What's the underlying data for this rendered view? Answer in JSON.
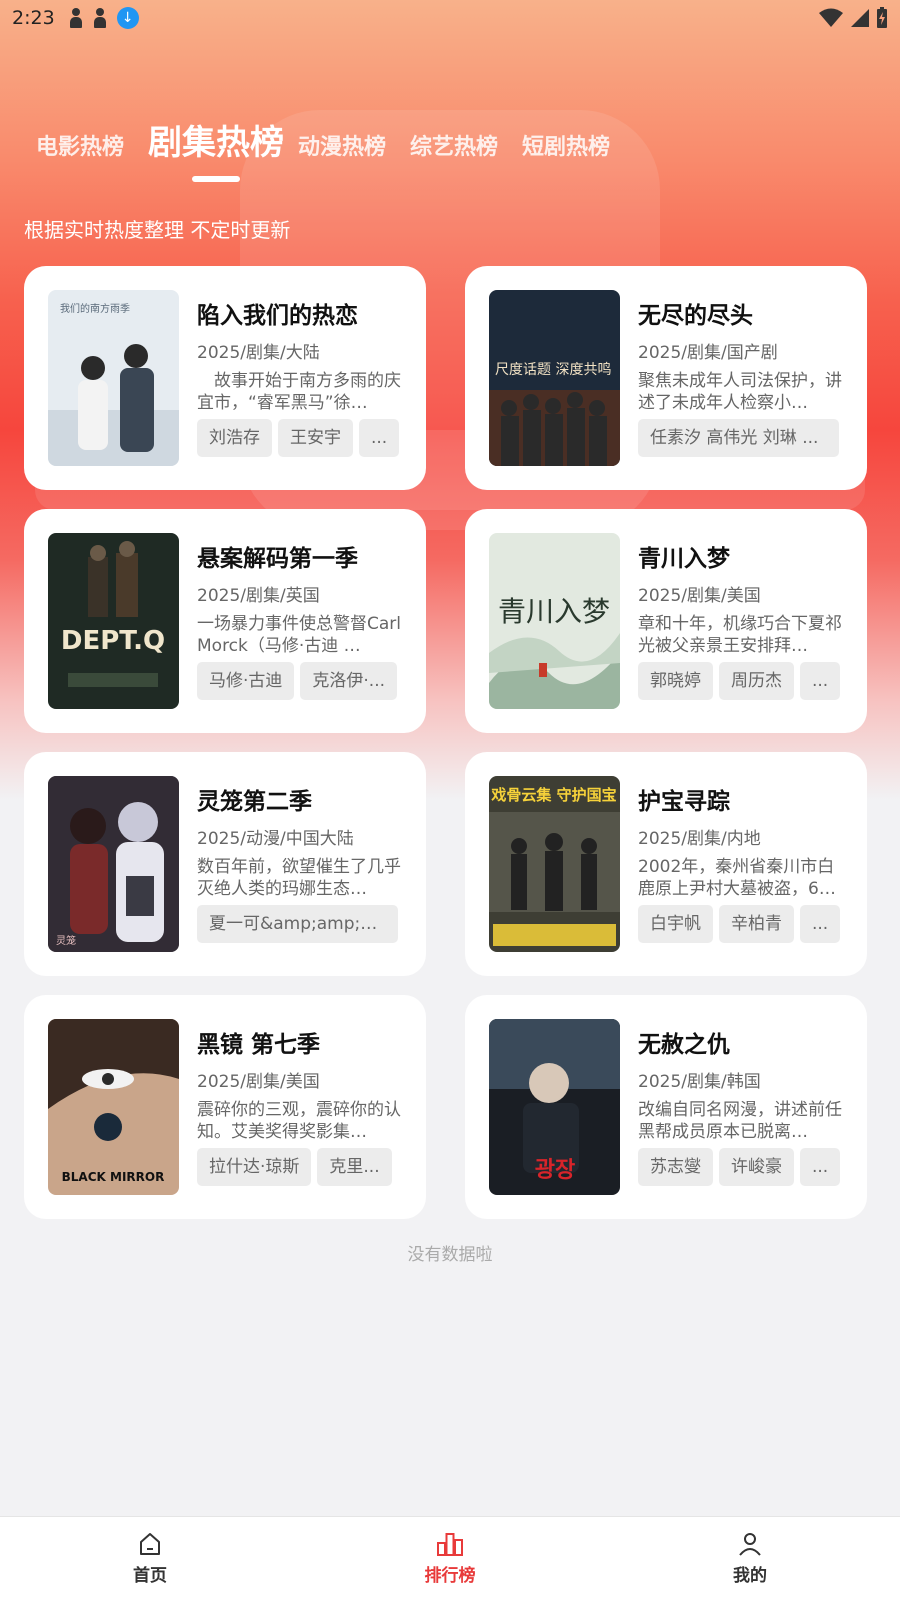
{
  "status_bar": {
    "time": "2:23"
  },
  "tabs": [
    {
      "label": "电影热榜",
      "active": false
    },
    {
      "label": "剧集热榜",
      "active": true
    },
    {
      "label": "动漫热榜",
      "active": false
    },
    {
      "label": "综艺热榜",
      "active": false
    },
    {
      "label": "短剧热榜",
      "active": false
    }
  ],
  "subtitle": "根据实时热度整理 不定时更新",
  "cards": [
    {
      "title": "陷入我们的热恋",
      "meta": "2025/剧集/大陆",
      "desc": "　故事开始于南方多雨的庆宜市，“睿军黑马”徐…",
      "tags": [
        "刘浩存",
        "王安宇",
        "..."
      ]
    },
    {
      "title": "无尽的尽头",
      "meta": "2025/剧集/国产剧",
      "desc": "聚焦未成年人司法保护，讲述了未成年人检察小…",
      "tags": [
        "任素汐 高伟光 刘琳 ..."
      ]
    },
    {
      "title": "悬案解码第一季",
      "meta": "2025/剧集/英国",
      "desc": "一场暴力事件使总警督Carl Morck（马修·古迪 …",
      "tags": [
        "马修·古迪",
        "克洛伊·..."
      ]
    },
    {
      "title": "青川入梦",
      "meta": "2025/剧集/美国",
      "desc": "章和十年，机缘巧合下夏祁光被父亲景王安排拜…",
      "tags": [
        "郭晓婷",
        "周历杰",
        "..."
      ]
    },
    {
      "title": "灵笼第二季",
      "meta": "2025/动漫/中国大陆",
      "desc": "数百年前，欲望催生了几乎灭绝人类的玛娜生态…",
      "tags": [
        "夏一可&amp;amp;nb..."
      ]
    },
    {
      "title": "护宝寻踪",
      "meta": "2025/剧集/内地",
      "desc": "2002年，秦州省秦川市白鹿原上尹村大墓被盗，6…",
      "tags": [
        "白宇帆",
        "辛柏青",
        "..."
      ]
    },
    {
      "title": "黑镜 第七季",
      "meta": "2025/剧集/美国",
      "desc": "震碎你的三观，震碎你的认知。艾美奖得奖影集…",
      "tags": [
        "拉什达·琼斯",
        "克里..."
      ]
    },
    {
      "title": "无赦之仇",
      "meta": "2025/剧集/韩国",
      "desc": "改编自同名网漫，讲述前任黑帮成员原本已脱离…",
      "tags": [
        "苏志燮",
        "许峻豪",
        "..."
      ]
    }
  ],
  "posters": [
    {
      "text": "我们的南方雨季",
      "colors": [
        "#e9eef2",
        "#c9d3dc"
      ]
    },
    {
      "text": "尺度话题 深度共鸣",
      "colors": [
        "#1d2a3a",
        "#5a3a2a"
      ]
    },
    {
      "text": "DEPT.Q",
      "colors": [
        "#1e2a24",
        "#3d3a2a"
      ]
    },
    {
      "text": "青川入梦",
      "colors": [
        "#dde6dc",
        "#9bb5a0"
      ]
    },
    {
      "text": "灵笼",
      "colors": [
        "#6a2a2a",
        "#2a2d3a"
      ]
    },
    {
      "text": "戏骨云集 守护国宝",
      "colors": [
        "#3a3a30",
        "#5a5a48"
      ]
    },
    {
      "text": "BLACK MIRROR",
      "colors": [
        "#c9a58a",
        "#3a2a22"
      ]
    },
    {
      "text": "광장",
      "colors": [
        "#3a4a5a",
        "#111418"
      ]
    }
  ],
  "footer": {
    "no_data": "没有数据啦"
  },
  "bottom_nav": [
    {
      "label": "首页",
      "icon": "home-icon",
      "active": false
    },
    {
      "label": "排行榜",
      "icon": "ranking-icon",
      "active": true
    },
    {
      "label": "我的",
      "icon": "user-icon",
      "active": false
    }
  ],
  "colors": {
    "accent": "#e83a3a",
    "hero_top": "#f8b18a",
    "hero_mid": "#f6463d"
  }
}
